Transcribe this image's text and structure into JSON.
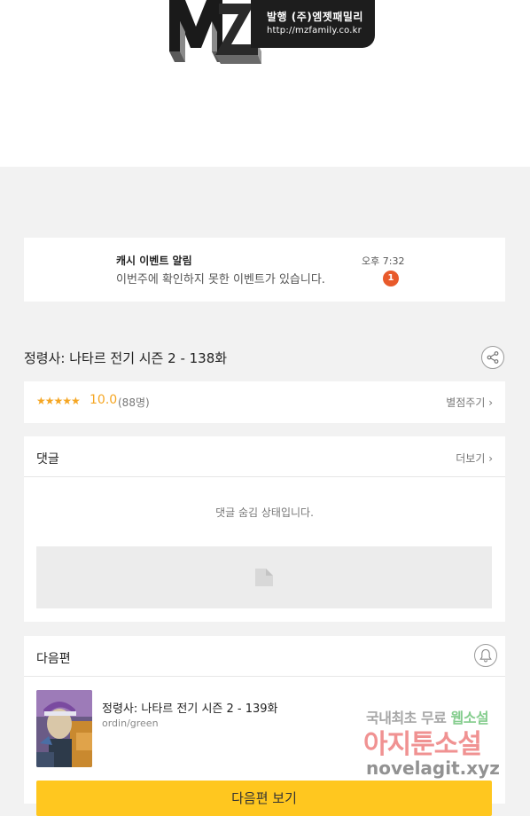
{
  "banner": {
    "logo_letters": "MZ",
    "publisher_line": "발행 (주)엠젯패밀리",
    "publisher_url": "http://mzfamily.co.kr"
  },
  "notice": {
    "title": "캐시 이벤트 알림",
    "message": "이번주에 확인하지 못한 이벤트가 있습니다.",
    "time": "오후 7:32",
    "badge_count": "1"
  },
  "episode": {
    "title": "정령사: 나타르 전기 시즌 2 - 138화",
    "share_icon": "share-icon"
  },
  "rating": {
    "stars": "★★★★★",
    "score": "10.0",
    "count": "(88명)",
    "rate_link": "별점주기 ›"
  },
  "comments": {
    "header": "댓글",
    "more_link": "더보기 ›",
    "hidden_message": "댓글 숨김 상태입니다."
  },
  "next_episode": {
    "header": "다음편",
    "bell_icon": "bell-icon",
    "item_title": "정령사: 나타르 전기 시즌 2 - 139화",
    "item_subtitle": "ordin/green",
    "button_label": "다음편 보기"
  },
  "watermark": {
    "line1_a": "국내최초 무료 ",
    "line1_b": "웹소설",
    "line2": "아지툰소설",
    "line3": "novelagit.xyz"
  },
  "colors": {
    "accent_yellow": "#ffc71f",
    "star_orange": "#f5a623",
    "badge_red": "#e85a2b",
    "page_bg": "#f2f2f2"
  }
}
